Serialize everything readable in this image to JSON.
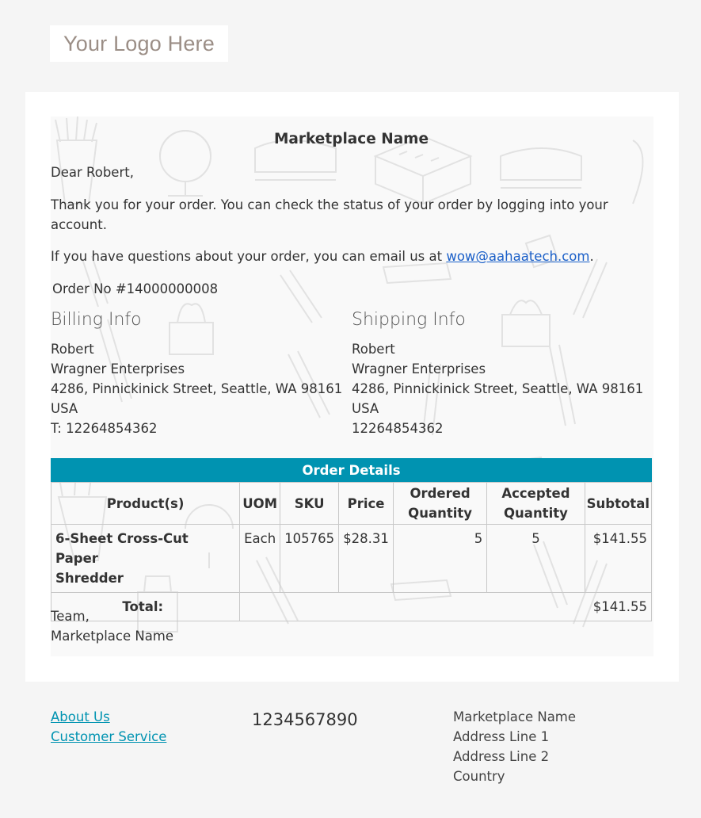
{
  "header": {
    "logo_text": "Your Logo Here"
  },
  "email": {
    "marketplace_title": "Marketplace Name",
    "greeting": "Dear Robert,",
    "thank_you": "Thank you for your order. You can check the status of your order by logging into your",
    "thank_you_cont": "account.",
    "questions_prefix": "If you have questions about your order, you can email us at ",
    "contact_email": "wow@aahaatech.com",
    "questions_suffix": ".",
    "order_no": "Order No #14000000008",
    "billing": {
      "heading": "Billing Info",
      "name": "Robert",
      "company": "Wragner Enterprises",
      "street": "4286, Pinnickinick Street, Seattle, WA 98161",
      "country": "USA",
      "phone": "T: 12264854362"
    },
    "shipping": {
      "heading": "Shipping Info",
      "name": "Robert",
      "company": "Wragner Enterprises",
      "street": "4286, Pinnickinick Street, Seattle, WA 98161",
      "country": "USA",
      "phone": "12264854362"
    },
    "order_details": {
      "title": "Order Details",
      "columns": {
        "product": "Product(s)",
        "uom": "UOM",
        "sku": "SKU",
        "price": "Price",
        "ordered_1": "Ordered",
        "ordered_2": "Quantity",
        "accepted_1": "Accepted",
        "accepted_2": "Quantity",
        "subtotal": "Subtotal"
      },
      "items": [
        {
          "product_1": "6-Sheet Cross-Cut Paper",
          "product_2": "Shredder",
          "uom": "Each",
          "sku": "105765",
          "price": "$28.31",
          "ordered_qty": "5",
          "accepted_qty": "5",
          "subtotal": "$141.55"
        }
      ],
      "total_label": "Total:",
      "total_value": "$141.55"
    },
    "signoff_1": "Team,",
    "signoff_2": "Marketplace Name"
  },
  "footer": {
    "links": [
      "About Us",
      "Customer Service"
    ],
    "phone": "1234567890",
    "address": [
      "Marketplace Name",
      "Address Line 1",
      "Address Line 2",
      "Country"
    ]
  },
  "colors": {
    "accent": "#0093b1",
    "link": "#1a5fc8",
    "page_bg": "#f5f5f5"
  }
}
